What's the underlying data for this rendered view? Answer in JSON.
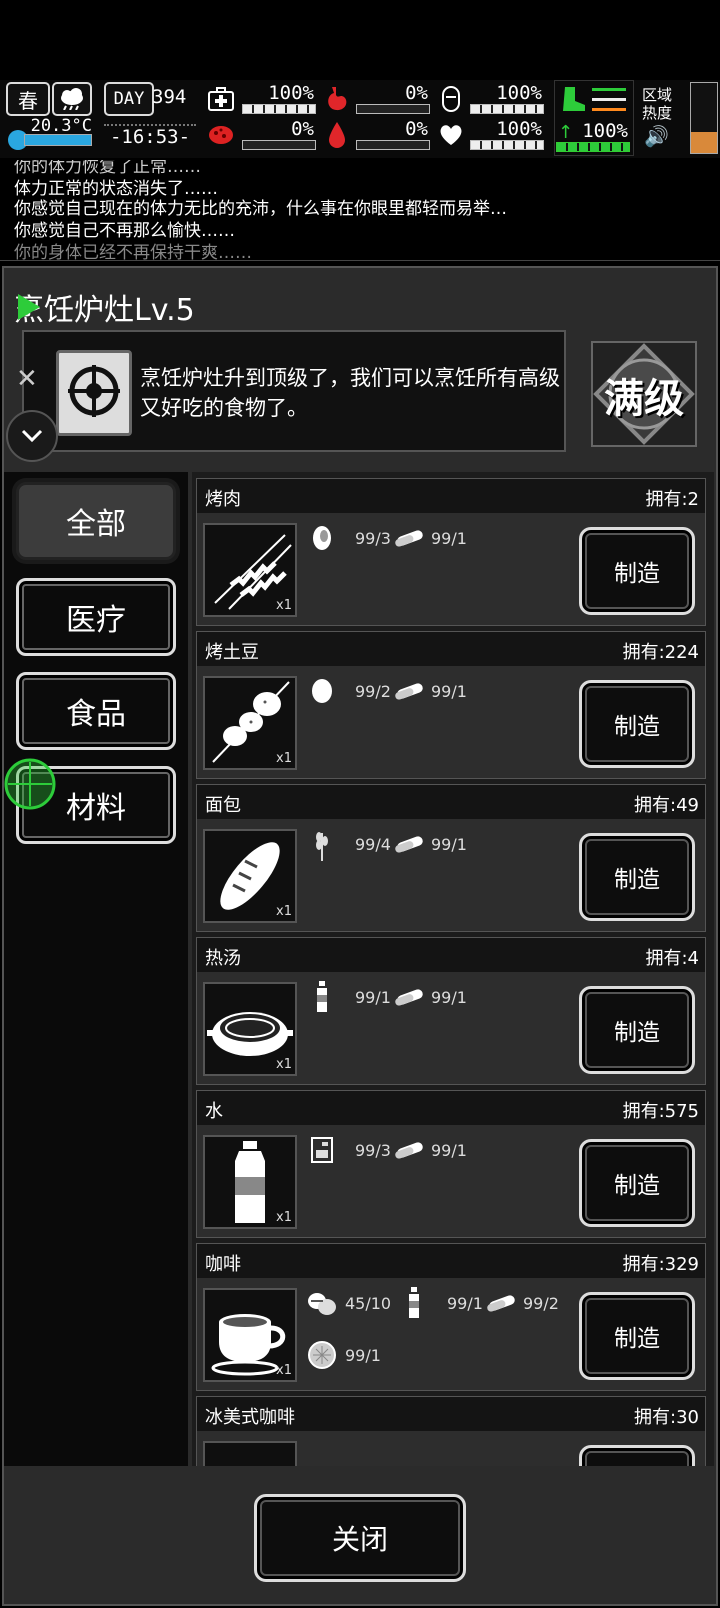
{
  "hud": {
    "season": "春",
    "temperature": "20.3°C",
    "day_label": "DAY",
    "day_value": "394",
    "time": "-16:53-",
    "stats": [
      {
        "name": "health",
        "value": "100%",
        "level": 1.0
      },
      {
        "name": "hunger",
        "value": "0%",
        "level": 0.0
      },
      {
        "name": "tiredness",
        "value": "100%",
        "level": 1.0
      },
      {
        "name": "infection",
        "value": "0%",
        "level": 0.0
      },
      {
        "name": "thirst",
        "value": "0%",
        "level": 0.0
      },
      {
        "name": "mood",
        "value": "100%",
        "level": 1.0
      }
    ],
    "stamina": "100%",
    "zone_heat_label": "区域\n热度",
    "zone_heat_line1": "区域",
    "zone_heat_line2": "热度"
  },
  "log": {
    "lines": [
      "你的体力恢复了正常……",
      "体力正常的状态消失了……",
      "你感觉自己现在的体力无比的充沛，什么事在你眼里都轻而易举…",
      "你感觉自己不再那么愉快……",
      "你的身体已经不再保持干爽……"
    ]
  },
  "panel": {
    "title": "烹饪炉灶Lv.5",
    "description": "烹饪炉灶升到顶级了，我们可以烹饪所有高级又好吃的食物了。",
    "max_level_badge": "满级"
  },
  "tabs": [
    {
      "label": "全部",
      "active": true
    },
    {
      "label": "医疗",
      "active": false
    },
    {
      "label": "食品",
      "active": false
    },
    {
      "label": "材料",
      "active": false
    }
  ],
  "make_label": "制造",
  "close_label": "关闭",
  "items": [
    {
      "name": "烤肉",
      "owned": "拥有:2",
      "qty": "x1",
      "icon": "skewer-meat-icon",
      "materials": [
        {
          "icon": "raw-meat-icon",
          "value": "99/3"
        },
        {
          "icon": "firewood-icon",
          "value": "99/1"
        }
      ]
    },
    {
      "name": "烤土豆",
      "owned": "拥有:224",
      "qty": "x1",
      "icon": "roast-potato-icon",
      "materials": [
        {
          "icon": "potato-icon",
          "value": "99/2"
        },
        {
          "icon": "firewood-icon",
          "value": "99/1"
        }
      ]
    },
    {
      "name": "面包",
      "owned": "拥有:49",
      "qty": "x1",
      "icon": "bread-icon",
      "materials": [
        {
          "icon": "wheat-icon",
          "value": "99/4"
        },
        {
          "icon": "firewood-icon",
          "value": "99/1"
        }
      ]
    },
    {
      "name": "热汤",
      "owned": "拥有:4",
      "qty": "x1",
      "icon": "soup-icon",
      "materials": [
        {
          "icon": "water-bottle-icon",
          "value": "99/1"
        },
        {
          "icon": "firewood-icon",
          "value": "99/1"
        }
      ]
    },
    {
      "name": "水",
      "owned": "拥有:575",
      "qty": "x1",
      "icon": "water-bottle-icon",
      "materials": [
        {
          "icon": "purifier-icon",
          "value": "99/3"
        },
        {
          "icon": "firewood-icon",
          "value": "99/1"
        }
      ]
    },
    {
      "name": "咖啡",
      "owned": "拥有:329",
      "qty": "x1",
      "icon": "coffee-cup-icon",
      "materials": [
        {
          "icon": "coffee-beans-icon",
          "value": "45/10"
        },
        {
          "icon": "water-bottle-icon",
          "value": "99/1"
        },
        {
          "icon": "firewood-icon",
          "value": "99/2"
        },
        {
          "icon": "filter-icon",
          "value": "99/1"
        }
      ]
    },
    {
      "name": "冰美式咖啡",
      "owned": "拥有:30",
      "qty": "",
      "icon": "iced-coffee-icon",
      "materials": []
    }
  ]
}
